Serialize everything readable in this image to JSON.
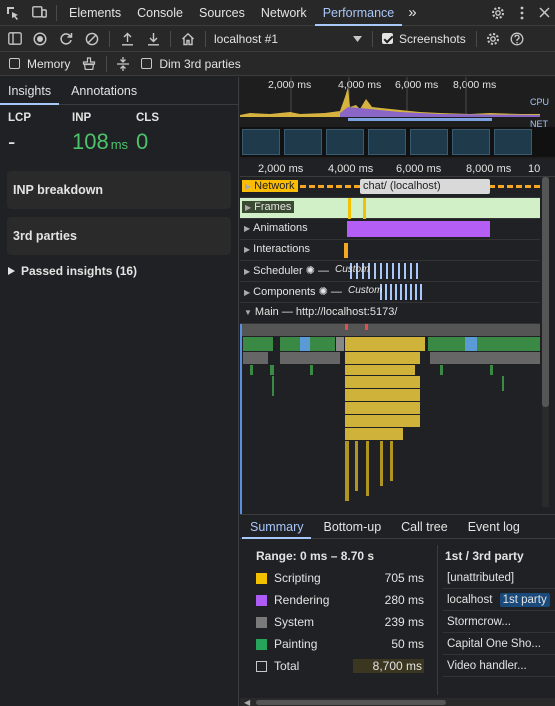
{
  "tabs": [
    "Elements",
    "Console",
    "Sources",
    "Network",
    "Performance"
  ],
  "tabs_overflow": "»",
  "toolbar": {
    "target_label": "localhost #1",
    "screenshots_label": "Screenshots",
    "memory_label": "Memory",
    "dim_label": "Dim 3rd parties"
  },
  "left": {
    "tabs": [
      "Insights",
      "Annotations"
    ],
    "metrics": [
      {
        "label": "LCP",
        "value": "-",
        "unit": ""
      },
      {
        "label": "INP",
        "value": "108",
        "unit": "ms"
      },
      {
        "label": "CLS",
        "value": "0",
        "unit": ""
      }
    ],
    "cards": [
      "INP breakdown",
      "3rd parties"
    ],
    "passed": "Passed insights (16)"
  },
  "timeline": {
    "overview_ticks": [
      "2,000 ms",
      "4,000 ms",
      "6,000 ms",
      "8,000 ms"
    ],
    "ruler_ticks": [
      "2,000 ms",
      "4,000 ms",
      "6,000 ms",
      "8,000 ms",
      "10"
    ],
    "cpu_label": "CPU",
    "net_label": "NET",
    "tracks": [
      "Network",
      "Frames",
      "Animations",
      "Interactions",
      "Scheduler",
      "Components"
    ],
    "network_request": "chat/ (localhost)",
    "custom_label": "Custom",
    "main_label": "Main — http://localhost:5173/"
  },
  "bottom": {
    "tabs": [
      "Summary",
      "Bottom-up",
      "Call tree",
      "Event log"
    ],
    "range": "Range: 0 ms – 8.70 s",
    "rows": [
      {
        "name": "Scripting",
        "value": "705 ms",
        "color": "#f2c200"
      },
      {
        "name": "Rendering",
        "value": "280 ms",
        "color": "#af5cf7"
      },
      {
        "name": "System",
        "value": "239 ms",
        "color": "#7a7a7a"
      },
      {
        "name": "Painting",
        "value": "50 ms",
        "color": "#26a45c"
      }
    ],
    "total_label": "Total",
    "total_value": "8,700 ms",
    "party_header": "1st / 3rd party",
    "party_rows": [
      "[unattributed]",
      "localhost",
      "Stormcrow...",
      "Capital One Sho...",
      "Video handler..."
    ],
    "first_party_badge": "1st party"
  },
  "colors": {
    "accent": "#a8c7fa",
    "inp_green": "#4cc36b",
    "frames_green": "#d2f0c8",
    "animation_purple": "#b45ef5",
    "scripting_yellow": "#f2c200",
    "main_green": "#3a8a45"
  }
}
